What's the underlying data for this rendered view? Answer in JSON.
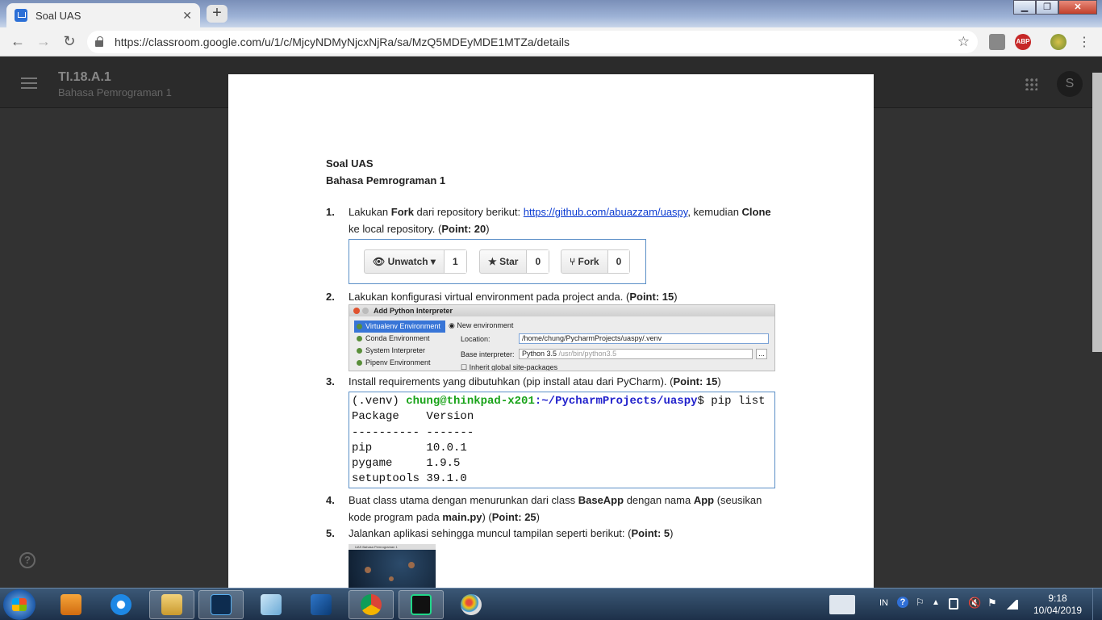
{
  "browser": {
    "tab_title": "Soal UAS",
    "tab_close": "✕",
    "new_tab": "+",
    "url": "https://classroom.google.com/u/1/c/MjcyNDMyNjcxNjRa/sa/MzQ5MDEyMDE1MTZa/details",
    "window_minimize": "▁",
    "window_restore": "❐",
    "window_close": "✕",
    "back": "←",
    "forward": "→",
    "reload": "↻",
    "star": "☆",
    "menu": "⋮",
    "ext_badge": "ABP"
  },
  "classroom": {
    "class_name": "TI.18.A.1",
    "class_subtitle": "Bahasa Pemrograman 1",
    "avatar_letter": "S",
    "help": "?"
  },
  "document": {
    "title_line1": "Soal UAS",
    "title_line2": "Bahasa Pemrograman 1",
    "items": [
      {
        "num": "1.",
        "t1": "Lakukan ",
        "b1": "Fork",
        "t2": " dari repository berikut: ",
        "link": "https://github.com/abuazzam/uaspy",
        "t3": ", kemudian ",
        "b2": "Clone",
        "t4": " ke local repository. (",
        "b3": "Point: 20",
        "t5": ")"
      },
      {
        "num": "2.",
        "t1": "Lakukan konfigurasi virtual environment pada project anda. (",
        "b1": "Point: 15",
        "t2": ")"
      },
      {
        "num": "3.",
        "t1": "Install requirements yang dibutuhkan (pip install atau dari PyCharm). (",
        "b1": "Point: 15",
        "t2": ")"
      },
      {
        "num": "4.",
        "t1": "Buat class utama dengan menurunkan dari class ",
        "b1": "BaseApp",
        "t2": " dengan nama ",
        "b2": "App",
        "t3": " (seusikan kode program pada ",
        "b3": "main.py",
        "t4": ") (",
        "b4": "Point: 25",
        "t5": ")"
      },
      {
        "num": "5.",
        "t1": "Jalankan aplikasi sehingga muncul tampilan seperti berikut: (",
        "b1": "Point: 5",
        "t2": ")"
      }
    ],
    "github_buttons": [
      {
        "icon": "👁",
        "label": "Unwatch ▾",
        "count": "1"
      },
      {
        "icon": "★",
        "label": "Star",
        "count": "0"
      },
      {
        "icon": "⑂",
        "label": "Fork",
        "count": "0"
      }
    ],
    "pycharm": {
      "dialog_title": "Add Python Interpreter",
      "sidebar": [
        "Virtualenv Environment",
        "Conda Environment",
        "System Interpreter",
        "Pipenv Environment"
      ],
      "new_env": "New environment",
      "location_label": "Location:",
      "location_value": "/home/chung/PycharmProjects/uaspy/.venv",
      "base_label": "Base interpreter:",
      "base_value": "Python 3.5",
      "base_path": "/usr/bin/python3.5",
      "inherit": "Inherit global site-packages",
      "browse": "..."
    },
    "terminal": {
      "prompt_env": "(.venv) ",
      "prompt_user": "chung@thinkpad-x201",
      "prompt_path": ":~/PycharmProjects/uaspy",
      "prompt_cmd": "$ pip list",
      "lines": [
        "Package    Version",
        "---------- -------",
        "pip        10.0.1",
        "pygame     1.9.5",
        "setuptools 39.1.0"
      ]
    },
    "game_caption": "UAS Bahasa Pemrograman 1"
  },
  "taskbar": {
    "language": "IN",
    "time": "9:18",
    "date": "10/04/2019"
  },
  "colors": {
    "accent_link": "#0b3bd1",
    "terminal_user": "#1aa31a",
    "terminal_path": "#2222cc"
  }
}
